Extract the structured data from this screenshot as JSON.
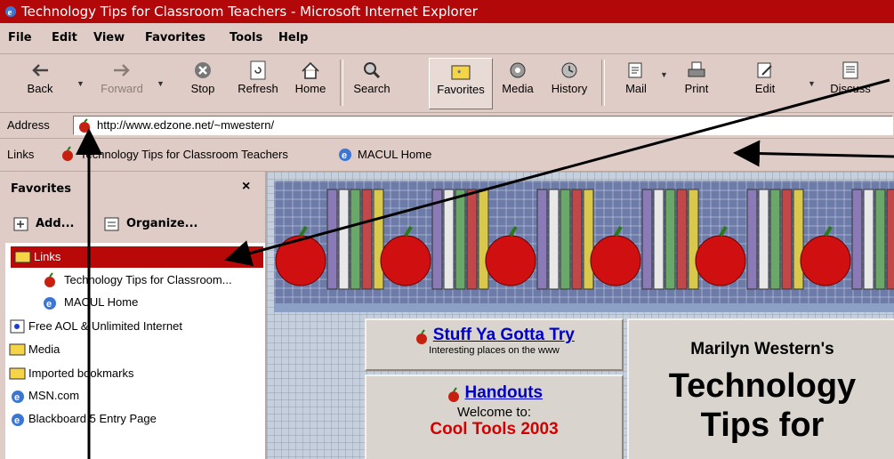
{
  "window": {
    "title": "Technology Tips for Classroom Teachers - Microsoft Internet Explorer"
  },
  "menu": [
    "File",
    "Edit",
    "View",
    "Favorites",
    "Tools",
    "Help"
  ],
  "toolbar": {
    "back": "Back",
    "forward": "Forward",
    "stop": "Stop",
    "refresh": "Refresh",
    "home": "Home",
    "search": "Search",
    "favorites": "Favorites",
    "media": "Media",
    "history": "History",
    "mail": "Mail",
    "print": "Print",
    "edit": "Edit",
    "discuss": "Discuss"
  },
  "address": {
    "label": "Address",
    "value": "http://www.edzone.net/~mwestern/"
  },
  "links": {
    "label": "Links",
    "items": [
      "Technology Tips for Classroom Teachers",
      "MACUL Home"
    ]
  },
  "favorites": {
    "title": "Favorites",
    "close": "×",
    "add": "Add...",
    "organize": "Organize...",
    "items": [
      {
        "label": "Links",
        "type": "folder"
      },
      {
        "label": "Technology Tips for Classroom...",
        "type": "apple"
      },
      {
        "label": "MACUL Home",
        "type": "ie"
      },
      {
        "label": "Free AOL & Unlimited Internet",
        "type": "aol"
      },
      {
        "label": "Media",
        "type": "folder"
      },
      {
        "label": "Imported bookmarks",
        "type": "folder"
      },
      {
        "label": "MSN.com",
        "type": "ie"
      },
      {
        "label": "Blackboard 5 Entry Page",
        "type": "ie"
      }
    ]
  },
  "page": {
    "stuff_link": "Stuff Ya Gotta Try",
    "stuff_sub": "Interesting places on the www",
    "handouts_link": "Handouts",
    "welcome": "Welcome to:",
    "cool_tools": "Cool Tools 2003",
    "author": "Marilyn Western's",
    "title_line1": "Technology",
    "title_line2": "Tips for"
  },
  "colors": {
    "titlebar": "#b2080a",
    "chrome": "#dfccc6",
    "selected": "#b80808",
    "link": "#0000cc"
  }
}
